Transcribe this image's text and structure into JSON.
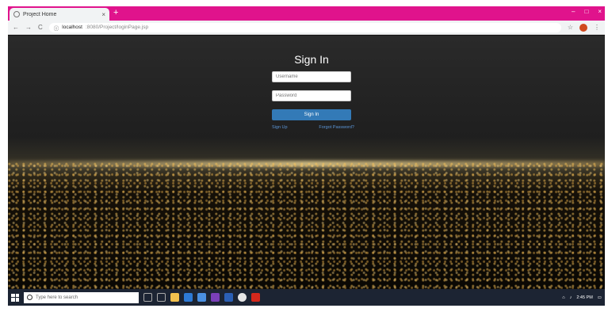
{
  "browser": {
    "tab_title": "Project Home",
    "tab_close": "×",
    "new_tab": "+",
    "window_minimize": "–",
    "window_maximize": "□",
    "window_close": "×",
    "back": "←",
    "forward": "→",
    "reload": "C",
    "url_host": "localhost",
    "url_path": ":8080/Project/loginPage.jsp",
    "star": "☆",
    "menu": "⋮"
  },
  "login": {
    "title": "Sign In",
    "username_placeholder": "Username",
    "password_placeholder": "Password",
    "submit_label": "Sign In",
    "signup_link": "Sign Up",
    "forgot_link": "Forgot Password?"
  },
  "taskbar": {
    "search_placeholder": "Type here to search",
    "time": "2:45 PM"
  },
  "colors": {
    "tab_strip": "#e0138c",
    "primary_button": "#337ab7",
    "link": "#5b95d6",
    "taskbar": "#1c2433"
  }
}
